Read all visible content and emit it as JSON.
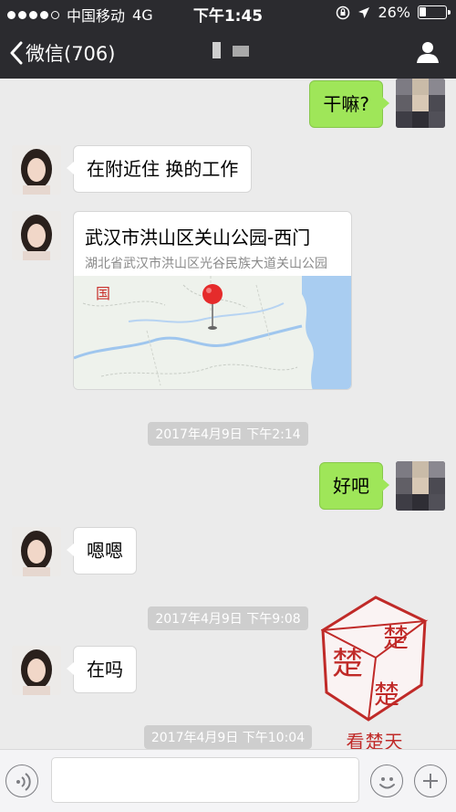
{
  "status_bar": {
    "carrier": "中国移动",
    "network": "4G",
    "time": "下午1:45",
    "battery_percent": "26%",
    "battery_level": 0.26
  },
  "nav": {
    "back_label": "微信(706)",
    "profile_icon": "person-icon"
  },
  "messages": [
    {
      "from": "me",
      "type": "text",
      "text": "干嘛?"
    },
    {
      "from": "her",
      "type": "text",
      "text": "在附近住  换的工作"
    },
    {
      "from": "her",
      "type": "location",
      "title": "武汉市洪山区关山公园-西门",
      "address": "湖北省武汉市洪山区光谷民族大道关山公园",
      "map_label": "国"
    },
    {
      "type": "timestamp",
      "text": "2017年4月9日 下午2:14"
    },
    {
      "from": "me",
      "type": "text",
      "text": "好吧"
    },
    {
      "from": "her",
      "type": "text",
      "text": "嗯嗯"
    },
    {
      "type": "timestamp",
      "text": "2017年4月9日 下午9:08"
    },
    {
      "from": "her",
      "type": "text",
      "text": "在吗"
    },
    {
      "type": "timestamp",
      "text": "2017年4月9日 下午10:04"
    }
  ],
  "watermark": {
    "stamp_text": "楚",
    "caption": "看楚天"
  },
  "input_bar": {
    "placeholder": "",
    "icons": [
      "voice-icon",
      "emoji-icon",
      "plus-icon"
    ]
  },
  "colors": {
    "bar_bg": "#2b2b2f",
    "chat_bg": "#ebebeb",
    "outgoing_bubble": "#9fe659",
    "incoming_bubble": "#ffffff",
    "timestamp_bg": "#cecece",
    "stamp_red": "#c02a28"
  }
}
